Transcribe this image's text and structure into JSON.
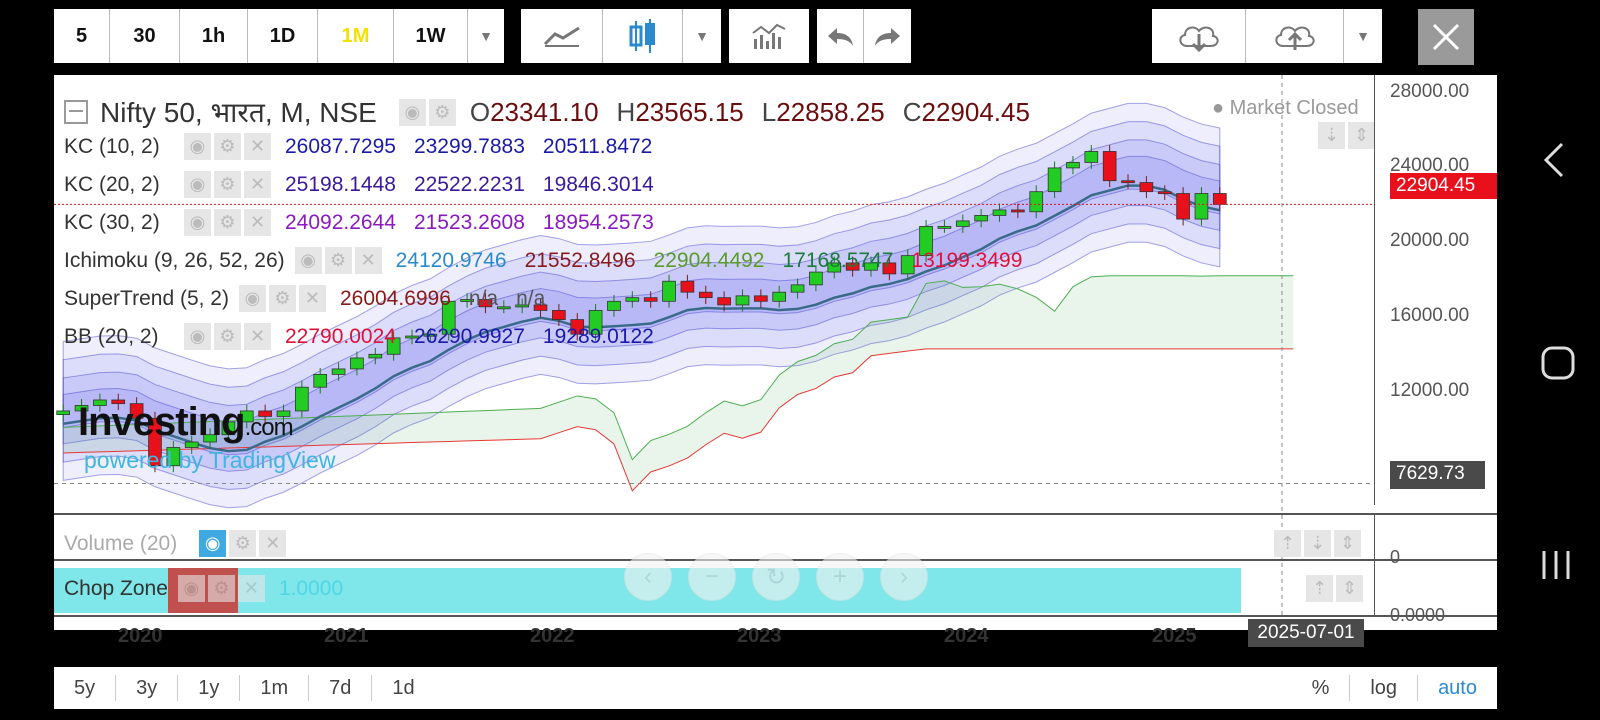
{
  "toolbar": {
    "intervals": [
      "5",
      "30",
      "1h",
      "1D",
      "1M",
      "1W"
    ],
    "active_interval": "1M"
  },
  "header": {
    "symbol": "Nifty 50, भारत, M, NSE",
    "open_label": "O",
    "open": "23341.10",
    "high_label": "H",
    "high": "23565.15",
    "low_label": "L",
    "low": "22858.25",
    "close_label": "C",
    "close": "22904.45",
    "market_status": "Market Closed"
  },
  "indicators": [
    {
      "name": "KC (10, 2)",
      "values": [
        "26087.7295",
        "23299.7883",
        "20511.8472"
      ],
      "colors": [
        "#1a1aaa",
        "#1a1aaa",
        "#1a1aaa"
      ]
    },
    {
      "name": "KC (20, 2)",
      "values": [
        "25198.1448",
        "22522.2231",
        "19846.3014"
      ],
      "colors": [
        "#3a1a9a",
        "#3a1a9a",
        "#3a1a9a"
      ]
    },
    {
      "name": "KC (30, 2)",
      "values": [
        "24092.2644",
        "21523.2608",
        "18954.2573"
      ],
      "colors": [
        "#8a1ac0",
        "#8a1ac0",
        "#8a1ac0"
      ]
    },
    {
      "name": "Ichimoku (9, 26, 52, 26)",
      "values": [
        "24120.9746",
        "21552.8496",
        "22904.4492",
        "17168.5747",
        "13199.3499"
      ],
      "colors": [
        "#2a8ad0",
        "#8a1a1a",
        "#5a9a2a",
        "#1a7a3a",
        "#e0103a"
      ]
    },
    {
      "name": "SuperTrend (5, 2)",
      "values": [
        "26004.6996",
        "n/a",
        "n/a"
      ],
      "colors": [
        "#8a1a1a",
        "#555",
        "#555"
      ]
    },
    {
      "name": "BB (20, 2)",
      "values": [
        "22790.0024",
        "26290.9927",
        "19289.0122"
      ],
      "colors": [
        "#e0103a",
        "#1a1aaa",
        "#1a1aaa"
      ]
    }
  ],
  "price_axis": {
    "ticks": [
      "28000.00",
      "24000.00",
      "20000.00",
      "16000.00",
      "12000.00"
    ],
    "last_price": "22904.45",
    "last_price_color": "#e8101a",
    "crosshair_price": "7629.73"
  },
  "time_axis": {
    "ticks": [
      "2020",
      "2021",
      "2022",
      "2023",
      "2024",
      "2025"
    ],
    "crosshair_date": "2025-07-01"
  },
  "watermark": {
    "brand": "Investing",
    "brand_suffix": ".com",
    "powered": "powered by TradingView"
  },
  "volume_pane": {
    "title": "Volume (20)",
    "axis_label": "0"
  },
  "chop_pane": {
    "title": "Chop Zone",
    "value": "1.0000",
    "axis_label": "0.0000",
    "fill_color": "#7fe6ea"
  },
  "bottom_bar": {
    "ranges": [
      "5y",
      "3y",
      "1y",
      "1m",
      "7d",
      "1d"
    ],
    "scale_options": [
      "%",
      "log",
      "auto"
    ],
    "active_scale": "auto"
  },
  "chart_data": {
    "type": "candlestick",
    "interval": "monthly",
    "x_ticks": [
      "2020",
      "2021",
      "2022",
      "2023",
      "2024",
      "2025"
    ],
    "ylim": [
      7000,
      29000
    ],
    "y_ticks": [
      28000,
      24000,
      20000,
      16000,
      12000
    ],
    "candles_approx_close": [
      11600,
      11900,
      12200,
      12000,
      11200,
      8600,
      9600,
      9900,
      10300,
      11000,
      11600,
      11300,
      11600,
      12900,
      13600,
      13900,
      14500,
      14700,
      15600,
      15700,
      15800,
      17600,
      17700,
      17300,
      17300,
      17400,
      17100,
      16600,
      15800,
      17100,
      17600,
      17800,
      17600,
      18700,
      18100,
      17800,
      17400,
      17900,
      17600,
      18100,
      18500,
      19200,
      19700,
      19300,
      19700,
      19100,
      20100,
      21700,
      21700,
      22000,
      22300,
      22600,
      22500,
      23600,
      24900,
      25200,
      25800,
      24200,
      24100,
      23600,
      23500,
      22100,
      23500,
      22904
    ],
    "last_close": 22904.45,
    "crosshair": {
      "price": 7629.73,
      "date": "2025-07-01"
    }
  }
}
